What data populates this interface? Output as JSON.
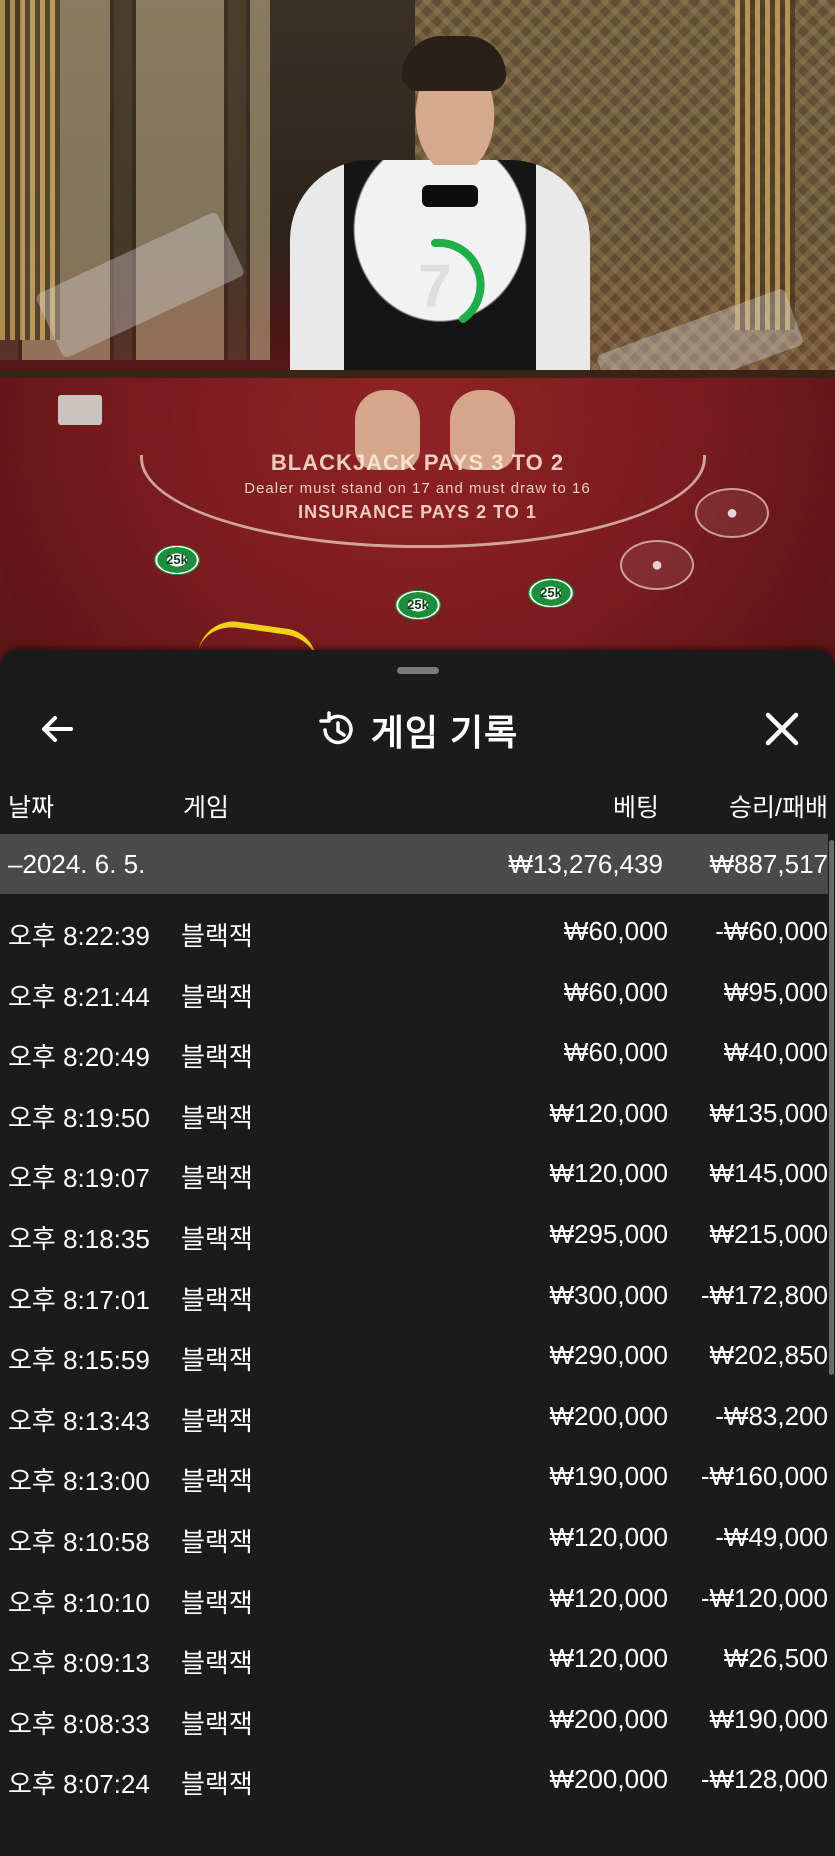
{
  "video": {
    "timer_value": "7",
    "table_text": {
      "line1": "BLACKJACK PAYS 3 TO 2",
      "line2": "Dealer must stand on 17 and must draw to 16",
      "line3": "INSURANCE PAYS 2 TO 1"
    },
    "chip_label": "25k",
    "timer_color": "#1fae4a"
  },
  "panel": {
    "title": "게임 기록",
    "back_icon": "arrow-left-icon",
    "history_icon": "history-icon",
    "close_icon": "close-icon"
  },
  "columns": {
    "date": "날짜",
    "game": "게임",
    "bet": "베팅",
    "win_loss": "승리/패배"
  },
  "day_summary": {
    "date": "–2024. 6. 5.",
    "bet_total": "₩13,276,439",
    "win_total": "₩887,517"
  },
  "rows": [
    {
      "time": "오후 8:22:39",
      "game": "블랙잭",
      "bet": "₩60,000",
      "win": "-₩60,000"
    },
    {
      "time": "오후 8:21:44",
      "game": "블랙잭",
      "bet": "₩60,000",
      "win": "₩95,000"
    },
    {
      "time": "오후 8:20:49",
      "game": "블랙잭",
      "bet": "₩60,000",
      "win": "₩40,000"
    },
    {
      "time": "오후 8:19:50",
      "game": "블랙잭",
      "bet": "₩120,000",
      "win": "₩135,000"
    },
    {
      "time": "오후 8:19:07",
      "game": "블랙잭",
      "bet": "₩120,000",
      "win": "₩145,000"
    },
    {
      "time": "오후 8:18:35",
      "game": "블랙잭",
      "bet": "₩295,000",
      "win": "₩215,000"
    },
    {
      "time": "오후 8:17:01",
      "game": "블랙잭",
      "bet": "₩300,000",
      "win": "-₩172,800"
    },
    {
      "time": "오후 8:15:59",
      "game": "블랙잭",
      "bet": "₩290,000",
      "win": "₩202,850"
    },
    {
      "time": "오후 8:13:43",
      "game": "블랙잭",
      "bet": "₩200,000",
      "win": "-₩83,200"
    },
    {
      "time": "오후 8:13:00",
      "game": "블랙잭",
      "bet": "₩190,000",
      "win": "-₩160,000"
    },
    {
      "time": "오후 8:10:58",
      "game": "블랙잭",
      "bet": "₩120,000",
      "win": "-₩49,000"
    },
    {
      "time": "오후 8:10:10",
      "game": "블랙잭",
      "bet": "₩120,000",
      "win": "-₩120,000"
    },
    {
      "time": "오후 8:09:13",
      "game": "블랙잭",
      "bet": "₩120,000",
      "win": "₩26,500"
    },
    {
      "time": "오후 8:08:33",
      "game": "블랙잭",
      "bet": "₩200,000",
      "win": "₩190,000"
    },
    {
      "time": "오후 8:07:24",
      "game": "블랙잭",
      "bet": "₩200,000",
      "win": "-₩128,000"
    }
  ],
  "colors": {
    "panel_bg": "#1b1b1b",
    "summary_bg": "#4a4a4a",
    "text": "#ffffff"
  }
}
